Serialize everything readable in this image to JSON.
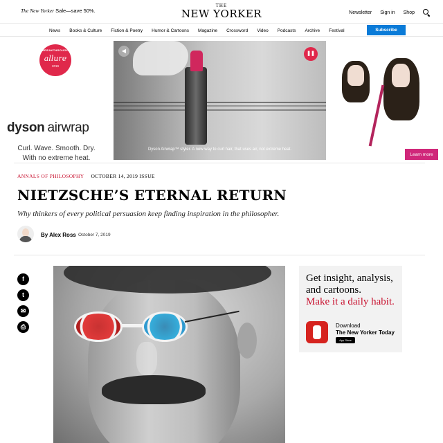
{
  "header": {
    "promo_italic": "The New Yorker",
    "promo_rest": " Sale—save 50%.",
    "logo_the": "THE",
    "logo_main": "NEW YORKER",
    "links": [
      "Newsletter",
      "Sign in",
      "Shop"
    ],
    "search_icon": "search-icon"
  },
  "nav": {
    "items": [
      "News",
      "Books & Culture",
      "Fiction & Poetry",
      "Humor & Cartoons",
      "Magazine",
      "Crossword",
      "Video",
      "Podcasts",
      "Archive",
      "Festival"
    ],
    "subscribe_label": "Subscribe",
    "subscribe_color": "#0a7bd8"
  },
  "ad": {
    "badge_top": "BREAKTHROUGH",
    "badge_main": "allure",
    "badge_year": "2019",
    "brand_bold": "dyson",
    "brand_light": "airwrap",
    "tagline_1": "Curl. Wave. Smooth. Dry.",
    "tagline_2": "With no extreme heat.",
    "caption": "Dyson Airwrap™ styler. A new way to curl hair, that uses air, not extreme heat.",
    "learn_more": "Learn more",
    "learn_more_color": "#d0277a"
  },
  "article": {
    "section": "ANNALS OF PHILOSOPHY",
    "issue": "OCTOBER 14, 2019 ISSUE",
    "headline": "NIETZSCHE’S ETERNAL RETURN",
    "dek": "Why thinkers of every political persuasion keep finding inspiration in the philosopher.",
    "byline": "By Alex Ross",
    "date": "October 7, 2019",
    "accent_color": "#c8102e"
  },
  "share": {
    "icons": [
      "facebook-icon",
      "twitter-icon",
      "email-icon",
      "print-icon"
    ]
  },
  "sidebar_promo": {
    "line1": "Get insight, analysis, and cartoons.",
    "line2": "Make it a daily habit.",
    "download": "Download",
    "app_name": "The New Yorker Today",
    "store_badge": "App Store"
  }
}
